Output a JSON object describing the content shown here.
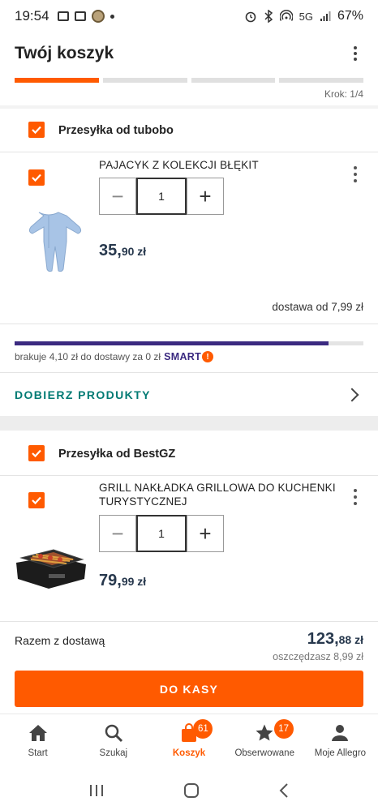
{
  "status_bar": {
    "time": "19:54",
    "network": "5G",
    "battery": "67%"
  },
  "header": {
    "title": "Twój koszyk",
    "step_label": "Krok: 1/4",
    "steps_total": 4,
    "current_step": 1
  },
  "shipments": [
    {
      "title": "Przesyłka od tubobo",
      "item": {
        "name": "PAJACYK Z KOLEKCJI BŁĘKIT",
        "quantity": "1",
        "price_main": "35,",
        "price_cents": "90 zł"
      },
      "delivery_from": "dostawa od 7,99 zł",
      "smart_progress": 0.9,
      "smart_text": "brakuje 4,10 zł do dostawy za 0 zł",
      "smart_logo": "SMART",
      "smart_badge": "!",
      "add_products_label": "DOBIERZ PRODUKTY"
    },
    {
      "title": "Przesyłka od BestGZ",
      "item": {
        "name": "GRILL NAKŁADKA GRILLOWA DO KUCHENKI TURYSTYCZNEJ",
        "quantity": "1",
        "price_main": "79,",
        "price_cents": "99 zł"
      }
    }
  ],
  "summary": {
    "total_label": "Razem z dostawą",
    "total_main": "123,",
    "total_cents": "88 zł",
    "savings": "oszczędzasz 8,99 zł",
    "checkout_label": "DO KASY"
  },
  "bottom_nav": [
    {
      "label": "Start",
      "icon": "home-icon"
    },
    {
      "label": "Szukaj",
      "icon": "search-icon"
    },
    {
      "label": "Koszyk",
      "icon": "bag-icon",
      "badge": "61",
      "active": true
    },
    {
      "label": "Obserwowane",
      "icon": "star-icon",
      "badge": "17"
    },
    {
      "label": "Moje Allegro",
      "icon": "user-icon"
    }
  ],
  "colors": {
    "accent": "#ff5a00",
    "smart": "#3b2a80",
    "link": "#007a73",
    "price": "#27384d"
  }
}
